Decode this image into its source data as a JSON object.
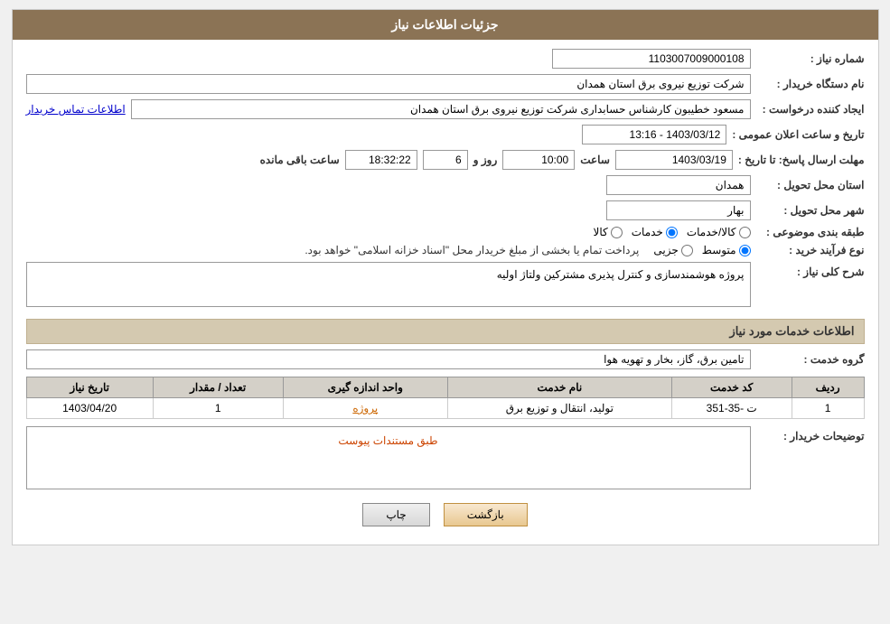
{
  "header": {
    "title": "جزئیات اطلاعات نیاز"
  },
  "fields": {
    "need_number_label": "شماره نیاز :",
    "need_number_value": "1103007009000108",
    "buyer_org_label": "نام دستگاه خریدار :",
    "buyer_org_value": "شرکت توزیع نیروی برق استان همدان",
    "creator_label": "ایجاد کننده درخواست :",
    "creator_name": "مسعود خطیبون کارشناس حسابداری شرکت توزیع نیروی برق استان همدان",
    "creator_link": "اطلاعات تماس خریدار",
    "announce_label": "تاریخ و ساعت اعلان عمومی :",
    "announce_value": "1403/03/12 - 13:16",
    "expire_label": "مهلت ارسال پاسخ: تا تاریخ :",
    "expire_date": "1403/03/19",
    "expire_time_label": "ساعت",
    "expire_time": "10:00",
    "expire_days_label": "روز و",
    "expire_days": "6",
    "expire_clock_label": "ساعت باقی مانده",
    "expire_clock": "18:32:22",
    "delivery_province_label": "استان محل تحویل :",
    "delivery_province_value": "همدان",
    "delivery_city_label": "شهر محل تحویل :",
    "delivery_city_value": "بهار",
    "category_label": "طبقه بندی موضوعی :",
    "category_options": [
      {
        "id": "kala",
        "label": "کالا"
      },
      {
        "id": "khadamat",
        "label": "خدمات"
      },
      {
        "id": "kala_khadamat",
        "label": "کالا/خدمات"
      }
    ],
    "category_selected": "khadamat",
    "purchase_type_label": "نوع فرآیند خرید :",
    "purchase_type_options": [
      {
        "id": "jozi",
        "label": "جزیی"
      },
      {
        "id": "motavaset",
        "label": "متوسط"
      }
    ],
    "purchase_type_selected": "motavaset",
    "purchase_type_note": "پرداخت تمام یا بخشی از مبلغ خریدار محل \"اسناد خزانه اسلامی\" خواهد بود.",
    "description_label": "شرح کلی نیاز :",
    "description_value": "پروژه هوشمندسازی و کنترل پذیری مشترکین ولتاژ اولیه"
  },
  "services_section": {
    "title": "اطلاعات خدمات مورد نیاز",
    "service_group_label": "گروه خدمت :",
    "service_group_value": "تامین برق، گاز، بخار و تهویه هوا",
    "table": {
      "columns": [
        "ردیف",
        "کد خدمت",
        "نام خدمت",
        "واحد اندازه گیری",
        "تعداد / مقدار",
        "تاریخ نیاز"
      ],
      "rows": [
        {
          "row_num": "1",
          "service_code": "ت -35-351",
          "service_name": "تولید، انتقال و توزیع برق",
          "unit": "پروژه",
          "qty": "1",
          "date": "1403/04/20"
        }
      ]
    }
  },
  "buyer_notes_label": "توضیحات خریدار :",
  "buyer_notes_placeholder": "طبق مستندات پیوست",
  "buttons": {
    "print": "چاپ",
    "back": "بازگشت"
  }
}
